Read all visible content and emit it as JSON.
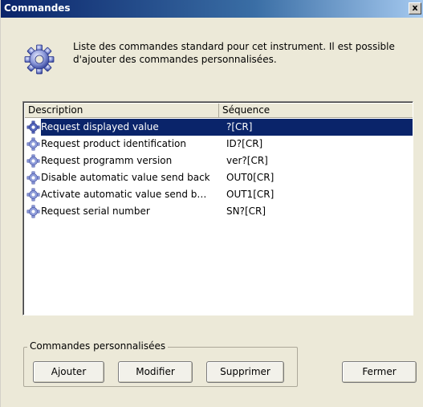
{
  "window": {
    "title": "Commandes",
    "close_label": "x"
  },
  "info": {
    "icon": "gear-icon",
    "text_line1": "Liste des commandes standard pour cet instrument. Il est possible",
    "text_line2": "d'ajouter des commandes personnalisées."
  },
  "list": {
    "columns": [
      "Description",
      "Séquence"
    ],
    "rows": [
      {
        "description": "Request displayed value",
        "sequence": "?[CR]",
        "selected": true
      },
      {
        "description": "Request product identification",
        "sequence": "ID?[CR]",
        "selected": false
      },
      {
        "description": "Request programm version",
        "sequence": "ver?[CR]",
        "selected": false
      },
      {
        "description": "Disable automatic value send back",
        "sequence": "OUT0[CR]",
        "selected": false
      },
      {
        "description": "Activate automatic value send b…",
        "sequence": "OUT1[CR]",
        "selected": false
      },
      {
        "description": "Request serial number",
        "sequence": "SN?[CR]",
        "selected": false
      }
    ]
  },
  "custom_group": {
    "label": "Commandes personnalisées",
    "add_label": "Ajouter",
    "edit_label": "Modifier",
    "delete_label": "Supprimer"
  },
  "close_button_label": "Fermer",
  "colors": {
    "title_bar": "#0a246a",
    "selection": "#0a246a",
    "dialog_bg": "#ece9d8"
  }
}
